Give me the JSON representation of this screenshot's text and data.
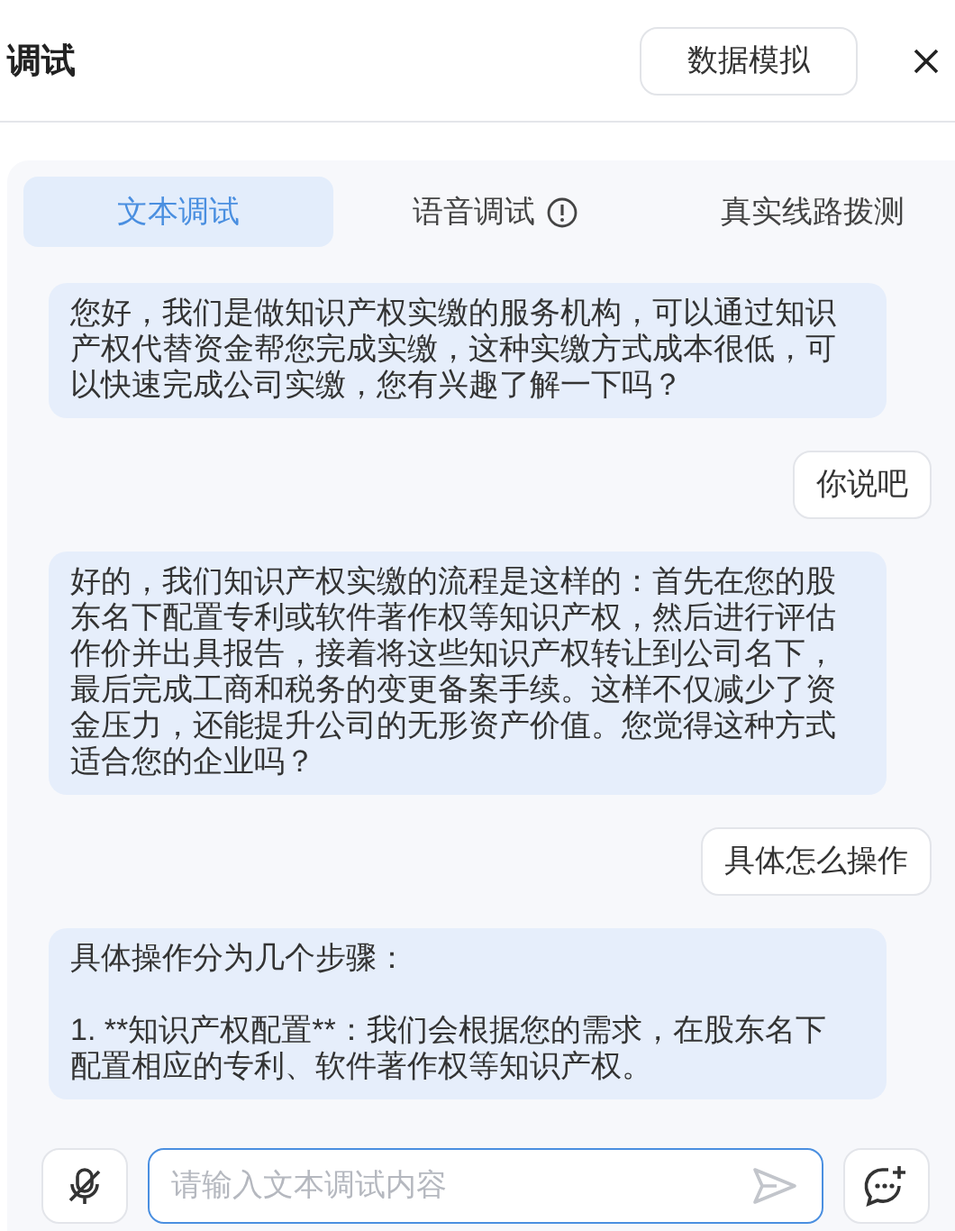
{
  "title": "调试",
  "header_button": "数据模拟",
  "tabs": [
    {
      "label": "文本调试",
      "selected": true,
      "kind": "plain"
    },
    {
      "label": "语音调试",
      "selected": false,
      "kind": "info"
    },
    {
      "label": "真实线路拨测",
      "selected": false,
      "kind": "plain"
    }
  ],
  "messages": [
    {
      "kind": "bot",
      "text": "您好，我们是做知识产权实缴的服务机构，可以通过知识产权代替资金帮您完成实缴，这种实缴方式成本很低，可以快速完成公司实缴，您有兴趣了解一下吗？"
    },
    {
      "kind": "user",
      "text": "你说吧"
    },
    {
      "kind": "bot",
      "text": "好的，我们知识产权实缴的流程是这样的：首先在您的股东名下配置专利或软件著作权等知识产权，然后进行评估作价并出具报告，接着将这些知识产权转让到公司名下，最后完成工商和税务的变更备案手续。这样不仅减少了资金压力，还能提升公司的无形资产价值。您觉得这种方式适合您的企业吗？"
    },
    {
      "kind": "user",
      "text": "具体怎么操作"
    },
    {
      "kind": "bot",
      "text": "具体操作分为几个步骤：\n\n1. **知识产权配置**：我们会根据您的需求，在股东名下配置相应的专利、软件著作权等知识产权。"
    }
  ],
  "input": {
    "placeholder": "请输入文本调试内容"
  }
}
